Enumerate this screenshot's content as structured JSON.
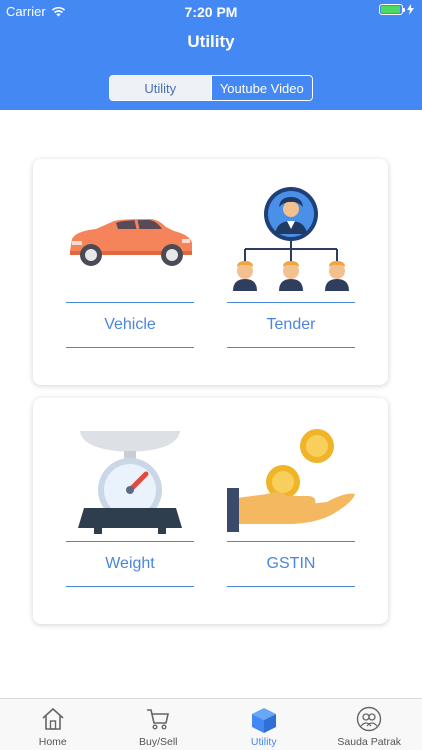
{
  "status_bar": {
    "carrier": "Carrier",
    "time": "7:20 PM"
  },
  "header": {
    "title": "Utility"
  },
  "segments": [
    {
      "label": "Utility",
      "active": true
    },
    {
      "label": "Youtube Video",
      "active": false
    }
  ],
  "cards": [
    {
      "tiles": [
        {
          "label": "Vehicle",
          "icon": "car-icon"
        },
        {
          "label": "Tender",
          "icon": "org-chart-icon"
        }
      ]
    },
    {
      "tiles": [
        {
          "label": "Weight",
          "icon": "weighing-scale-icon"
        },
        {
          "label": "GSTIN",
          "icon": "coins-hand-icon"
        }
      ]
    }
  ],
  "tabbar": {
    "items": [
      {
        "label": "Home",
        "icon": "home-icon"
      },
      {
        "label": "Buy/Sell",
        "icon": "cart-icon"
      },
      {
        "label": "Utility",
        "icon": "cube-icon",
        "active": true
      },
      {
        "label": "Sauda Patrak",
        "icon": "users-icon"
      }
    ]
  },
  "colors": {
    "brand": "#4488f4",
    "accent_text": "#4a86e0",
    "battery": "#4cd964"
  }
}
